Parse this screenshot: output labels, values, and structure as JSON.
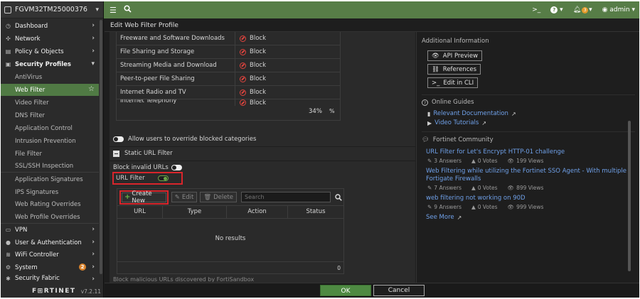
{
  "device": {
    "hostname": "FGVM32TM25000376"
  },
  "topbar": {
    "cli_icon": ">_",
    "help_icon": "?",
    "alert_count": "3",
    "user": "admin"
  },
  "sidebar": {
    "items": [
      {
        "label": "Dashboard",
        "icon": "dashboard-icon",
        "glyph": "◷"
      },
      {
        "label": "Network",
        "icon": "network-icon",
        "glyph": "✣"
      },
      {
        "label": "Policy & Objects",
        "icon": "policy-icon",
        "glyph": "▤"
      },
      {
        "label": "Security Profiles",
        "icon": "lock-icon",
        "glyph": "🔒"
      },
      {
        "label": "AntiVirus"
      },
      {
        "label": "Web Filter"
      },
      {
        "label": "Video Filter"
      },
      {
        "label": "DNS Filter"
      },
      {
        "label": "Application Control"
      },
      {
        "label": "Intrusion Prevention"
      },
      {
        "label": "File Filter"
      },
      {
        "label": "SSL/SSH Inspection"
      },
      {
        "label": "Application Signatures"
      },
      {
        "label": "IPS Signatures"
      },
      {
        "label": "Web Rating Overrides"
      },
      {
        "label": "Web Profile Overrides"
      },
      {
        "label": "VPN",
        "icon": "vpn-icon",
        "glyph": "▭"
      },
      {
        "label": "User & Authentication",
        "icon": "user-icon",
        "glyph": "👤"
      },
      {
        "label": "WiFi Controller",
        "icon": "wifi-icon",
        "glyph": "≋"
      },
      {
        "label": "System",
        "icon": "gear-icon",
        "glyph": "⚙",
        "badge": "2"
      },
      {
        "label": "Security Fabric",
        "icon": "fabric-icon",
        "glyph": "✱"
      }
    ],
    "logo": "F⊞RTINET",
    "version": "v7.2.11"
  },
  "page": {
    "title": "Edit Web Filter Profile"
  },
  "categories": {
    "rows": [
      {
        "name": "Freeware and Software Downloads",
        "action": "Block"
      },
      {
        "name": "File Sharing and Storage",
        "action": "Block"
      },
      {
        "name": "Streaming Media and Download",
        "action": "Block"
      },
      {
        "name": "Peer-to-peer File Sharing",
        "action": "Block"
      },
      {
        "name": "Internet Radio and TV",
        "action": "Block"
      },
      {
        "name": "Internet Telephony",
        "action": "Block"
      }
    ],
    "percent": "34%",
    "percent_symbol": "%"
  },
  "override": {
    "label": "Allow users to override blocked categories",
    "enabled": false
  },
  "static_url_filter": {
    "heading": "Static URL Filter",
    "block_invalid_label": "Block invalid URLs",
    "block_invalid_enabled": false,
    "url_filter_label": "URL Filter",
    "url_filter_enabled": true
  },
  "url_table": {
    "create_label": "Create New",
    "edit_label": "Edit",
    "delete_label": "Delete",
    "search_placeholder": "Search",
    "columns": [
      "URL",
      "Type",
      "Action",
      "Status"
    ],
    "empty_text": "No results",
    "count": "0"
  },
  "cut_text": "Block malicious URLs discovered by FortiSandbox",
  "right_panel": {
    "additional_heading": "Additional Information",
    "api_preview": "API Preview",
    "references": "References",
    "edit_cli": "Edit in CLI",
    "guides_heading": "Online Guides",
    "relevant_docs": "Relevant Documentation",
    "video_tutorials": "Video Tutorials",
    "community_heading": "Fortinet Community",
    "posts": [
      {
        "title": "URL Filter for Let's Encrypt HTTP-01 challenge",
        "answers": "3 Answers",
        "votes": "0 Votes",
        "views": "199 Views"
      },
      {
        "title": "Web Filtering while utilizing the Fortinet SSO Agent - With multiple",
        "title2": "Fortigate Firewalls",
        "answers": "7 Answers",
        "votes": "0 Votes",
        "views": "899 Views"
      },
      {
        "title": "web filtering not working on 90D",
        "answers": "9 Answers",
        "votes": "0 Votes",
        "views": "999 Views"
      }
    ],
    "see_more": "See More"
  },
  "actions": {
    "ok": "OK",
    "cancel": "Cancel"
  },
  "colors": {
    "accent_green": "#577d47",
    "ok_green": "#4e8a42",
    "highlight_red": "#d9252b",
    "link_blue": "#6fa0e8",
    "block_red": "#e0443e"
  }
}
